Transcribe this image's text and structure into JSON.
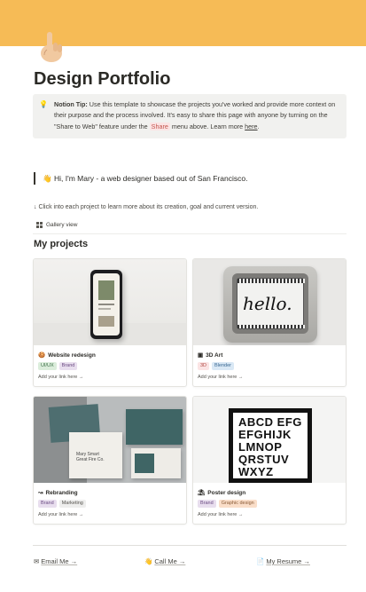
{
  "page": {
    "title": "Design Portfolio",
    "cover_color": "#f6bb56",
    "icon": "hand-pointing-icon"
  },
  "callout": {
    "icon": "light-bulb-icon",
    "tip_label": "Notion Tip:",
    "text_before": " Use this template to showcase the projects you've worked and provide more context on their purpose and the process involved. It's easy to share this page with anyone by turning on the \"Share to Web\" feature under the ",
    "share_pill": "Share",
    "text_middle": " menu above. Learn more ",
    "link_text": "here",
    "text_after": "."
  },
  "intro": {
    "emoji": "👋",
    "text": "Hi, I'm Mary - a web designer based out of San Francisco."
  },
  "hint": "↓ Click into each project to learn more about its creation, goal and current version.",
  "gallery_view_label": "Gallery view",
  "section_title": "My projects",
  "projects": [
    {
      "icon": "🍪",
      "title": "Website redesign",
      "tags": [
        {
          "label": "UI/UX",
          "bg": "#dbeddb",
          "fg": "#3a6e45"
        },
        {
          "label": "Brand",
          "bg": "#e8deee",
          "fg": "#6a4a82"
        }
      ],
      "link": "Add your link here →"
    },
    {
      "icon": "▣",
      "title": "3D Art",
      "tags": [
        {
          "label": "3D",
          "bg": "#fbe4e4",
          "fg": "#b04a44"
        },
        {
          "label": "Blender",
          "bg": "#d9e8f5",
          "fg": "#3a6892"
        }
      ],
      "link": "Add your link here →"
    },
    {
      "icon": "↝",
      "title": "Rebranding",
      "tags": [
        {
          "label": "Brand",
          "bg": "#e8deee",
          "fg": "#6a4a82"
        },
        {
          "label": "Marketing",
          "bg": "#eeeeed",
          "fg": "#55534e"
        }
      ],
      "link": "Add your link here →"
    },
    {
      "icon": "⛱",
      "title": "Poster design",
      "tags": [
        {
          "label": "Brand",
          "bg": "#e8deee",
          "fg": "#6a4a82"
        },
        {
          "label": "Graphic design",
          "bg": "#fadec9",
          "fg": "#8a5a35"
        }
      ],
      "link": "Add your link here →"
    }
  ],
  "poster_letters": [
    "ABCD EFG",
    "EFGHIJK",
    "LMNOP",
    "QRSTUV",
    "WXYZ"
  ],
  "hello_word": "hello.",
  "footer": [
    {
      "icon": "✉",
      "label": "Email Me →"
    },
    {
      "icon": "👋",
      "label": "Call Me →"
    },
    {
      "icon": "📄",
      "label": "My Resume →"
    }
  ]
}
